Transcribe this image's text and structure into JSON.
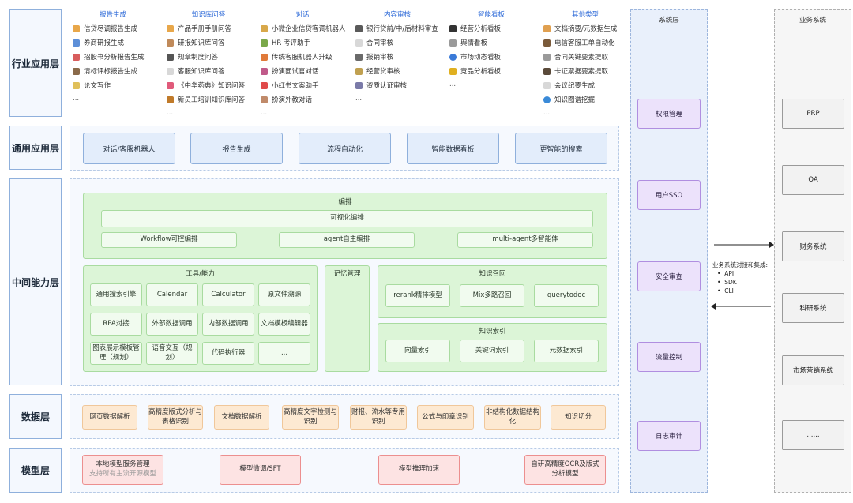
{
  "layers": {
    "industry": "行业应用层",
    "general": "通用应用层",
    "middle": "中间能力层",
    "data": "数据层",
    "model": "模型层"
  },
  "industry": {
    "columns": [
      {
        "title": "报告生成",
        "items": [
          "信贷尽调报告生成",
          "券商研报生成",
          "招股书分析报告生成",
          "清标评标报告生成",
          "论文写作",
          "..."
        ]
      },
      {
        "title": "知识库问答",
        "items": [
          "产品手册手册问答",
          "研报知识库问答",
          "规章制度问答",
          "客服知识库问答",
          "《中华药典》知识问答",
          "新员工培训知识库问答",
          "..."
        ]
      },
      {
        "title": "对话",
        "items": [
          "小微企业信贷客调机器人",
          "HR 考评助手",
          "传统客服机器人升级",
          "扮演面试官对话",
          "小红书文案助手",
          "扮演外教对话",
          "..."
        ]
      },
      {
        "title": "内容审核",
        "items": [
          "银行贷前/中/后材料审查",
          "合同审核",
          "报销审核",
          "经营贷审核",
          "资质认证审核",
          "..."
        ]
      },
      {
        "title": "智能看板",
        "items": [
          "经营分析看板",
          "舆情看板",
          "市场动态看板",
          "竞品分析看板",
          "..."
        ]
      },
      {
        "title": "其他类型",
        "items": [
          "文档摘要/元数据生成",
          "电信客服工单自动化",
          "合同关键要素提取",
          "卡证票据要素提取",
          "会议纪要生成",
          "知识图谱挖掘",
          "..."
        ]
      }
    ]
  },
  "general_apps": [
    "对话/客服机器人",
    "报告生成",
    "流程自动化",
    "智能数据看板",
    "更智能的搜索"
  ],
  "middle": {
    "orchestration": {
      "title": "编排",
      "visual": "可视化编排",
      "items": [
        "Workflow可控编排",
        "agent自主编排",
        "multi-agent多智能体"
      ]
    },
    "tools": {
      "title": "工具/能力",
      "items": [
        "通用搜索引擎",
        "Calendar",
        "Calculator",
        "原文件溯源",
        "RPA对接",
        "外部数据调用",
        "内部数据调用",
        "文档模板编辑器",
        "图表展示模板管理（规划）",
        "语音交互（规划）",
        "代码执行器",
        "..."
      ]
    },
    "memory": {
      "title": "记忆管理"
    },
    "recall": {
      "title": "知识召回",
      "items": [
        "rerank精排模型",
        "Mix多路召回",
        "querytodoc"
      ]
    },
    "index": {
      "title": "知识索引",
      "items": [
        "向量索引",
        "关键词索引",
        "元数据索引"
      ]
    }
  },
  "data_layer": [
    "网页数据解析",
    "高精度版式分析与表格识别",
    "文档数据解析",
    "高精度文字检测与识别",
    "财报、流水等专用识别",
    "公式与印章识别",
    "非结构化数据结构化",
    "知识切分"
  ],
  "model_layer": {
    "local": {
      "title": "本地模型服务管理",
      "sub": "支持所有主流开源模型"
    },
    "items": [
      "模型微调/SFT",
      "模型推理加速",
      "自研高精度OCR及版式分析模型"
    ]
  },
  "system": {
    "title": "系统层",
    "items": [
      "权限管理",
      "用户SSO",
      "安全审查",
      "流量控制",
      "日志审计"
    ]
  },
  "integration": {
    "title": "业务系统对接和集成:",
    "bullets": [
      "API",
      "SDK",
      "CLI"
    ]
  },
  "business": {
    "title": "业务系统",
    "items": [
      "PRP",
      "OA",
      "财务系统",
      "科研系统",
      "市场营销系统",
      "......"
    ]
  },
  "colors": {
    "blue": "#8fb0dc",
    "green": "#a9dba0",
    "orange": "#f0c79a",
    "red": "#ec8f8f",
    "purple": "#b08ee0",
    "link": "#2f6bd8"
  }
}
